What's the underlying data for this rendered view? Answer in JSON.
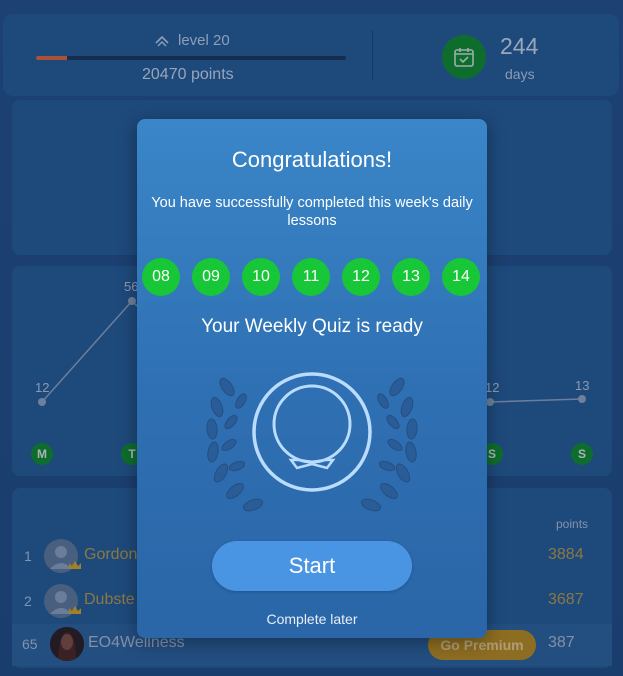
{
  "header": {
    "level_label": "level 20",
    "points_label": "20470 points",
    "level_progress": 0.1,
    "days_count": "244",
    "days_label": "days",
    "level_icon": "chevron-up-icon",
    "calendar_icon": "calendar-check-icon"
  },
  "weekly_chart": {
    "visible_values": [
      "12",
      "56",
      "12",
      "13"
    ],
    "visible_days": [
      "M",
      "T",
      "S",
      "S"
    ]
  },
  "leaderboard": {
    "points_header": "points",
    "rows": [
      {
        "rank": "1",
        "name": "Gordon",
        "points": "3884"
      },
      {
        "rank": "2",
        "name": "Dubste",
        "points": "3687"
      }
    ],
    "me": {
      "rank": "65",
      "name": "EO4Wellness",
      "points": "387",
      "premium_label": "Go Premium"
    }
  },
  "modal": {
    "title": "Congratulations!",
    "subtitle": "You have successfully completed this week's daily lessons",
    "days": [
      "08",
      "09",
      "10",
      "11",
      "12",
      "13",
      "14"
    ],
    "quiz_ready": "Your Weekly Quiz is ready",
    "start_label": "Start",
    "later_label": "Complete later",
    "badge_icon": "laurel-badge-icon"
  },
  "colors": {
    "day_complete": "#17c738",
    "accent_button": "#4a95e3",
    "premium": "#b88a1a",
    "progress": "#e0643a"
  }
}
